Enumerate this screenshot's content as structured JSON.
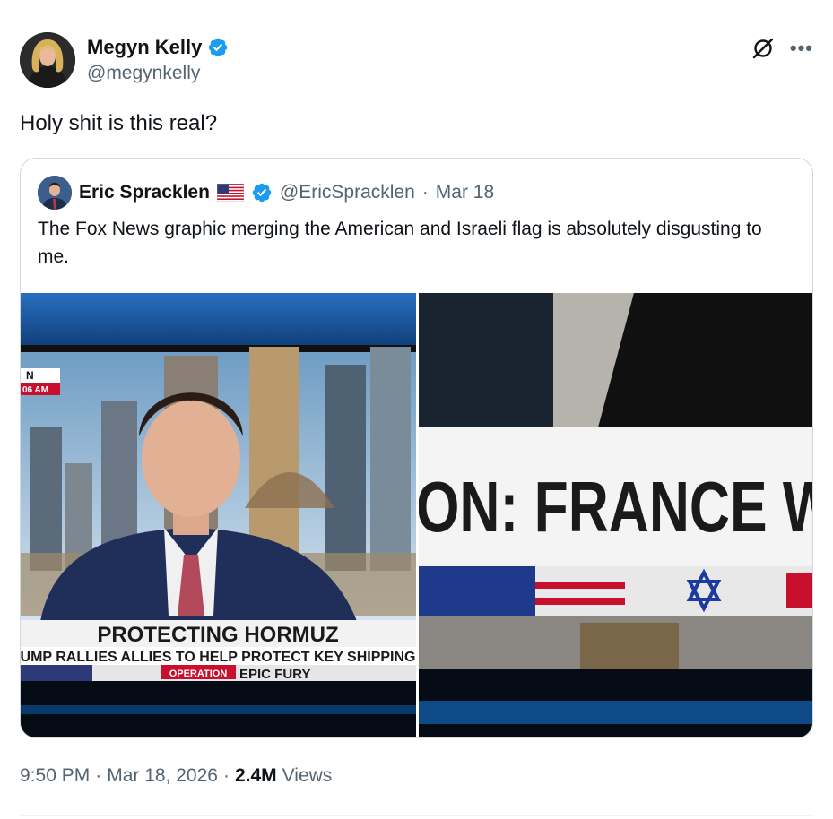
{
  "tweet": {
    "author_name": "Megyn Kelly",
    "author_handle": "@megynkelly",
    "text": "Holy shit is this real?",
    "time": "9:50 PM",
    "separator": "·",
    "date": "Mar 18, 2026",
    "views_count": "2.4M",
    "views_label": "Views"
  },
  "quote": {
    "author_name": "Eric Spracklen",
    "author_handle": "@EricSpracklen",
    "separator": "·",
    "date": "Mar 18",
    "text": "The Fox News graphic merging the American and Israeli flag is absolutely disgusting to me."
  },
  "media_left": {
    "corner_tag": "N",
    "corner_time": "06 AM",
    "headline": "PROTECTING HORMUZ",
    "subheadline": "UMP RALLIES ALLIES TO HELP PROTECT KEY SHIPPING",
    "operation_label": "OPERATION",
    "operation_name": "EPIC FURY"
  },
  "media_right": {
    "banner_text": "ON: FRANCE WI"
  },
  "icons": {
    "verified": "verified-badge-icon",
    "grok": "grok-icon",
    "more": "more-icon",
    "flag": "us-flag-icon"
  },
  "colors": {
    "verified": "#1d9bf0",
    "text_primary": "#0f1419",
    "text_secondary": "#536471",
    "border": "#cfd9de"
  }
}
